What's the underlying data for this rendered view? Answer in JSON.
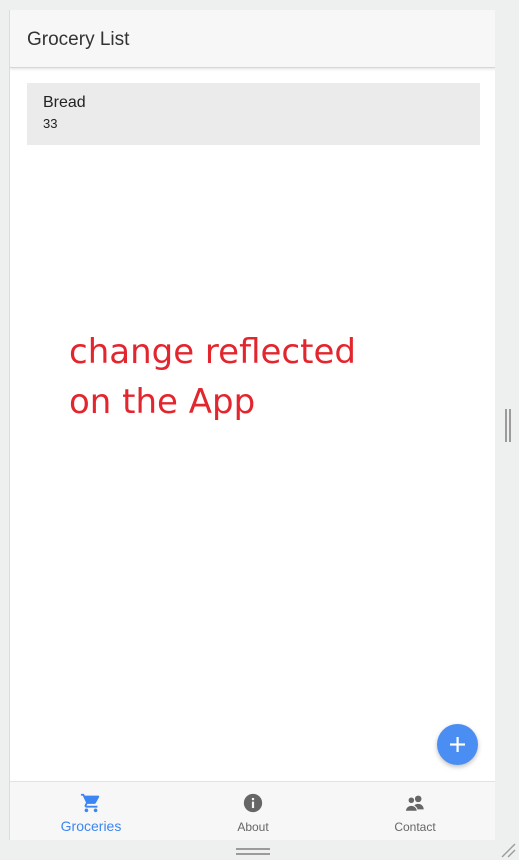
{
  "app_bar": {
    "title": "Grocery List"
  },
  "list": {
    "items": [
      {
        "name": "Bread",
        "quantity": "33"
      }
    ]
  },
  "annotation": {
    "line1": "change reflected",
    "line2": "on the App",
    "color": "#e3262e"
  },
  "fab": {
    "icon": "plus-icon",
    "color": "#4a8ef4"
  },
  "bottom_nav": {
    "items": [
      {
        "label": "Groceries",
        "icon": "cart-icon",
        "active": true
      },
      {
        "label": "About",
        "icon": "info-icon",
        "active": false
      },
      {
        "label": "Contact",
        "icon": "contacts-icon",
        "active": false
      }
    ],
    "active_color": "#3b86f2"
  }
}
